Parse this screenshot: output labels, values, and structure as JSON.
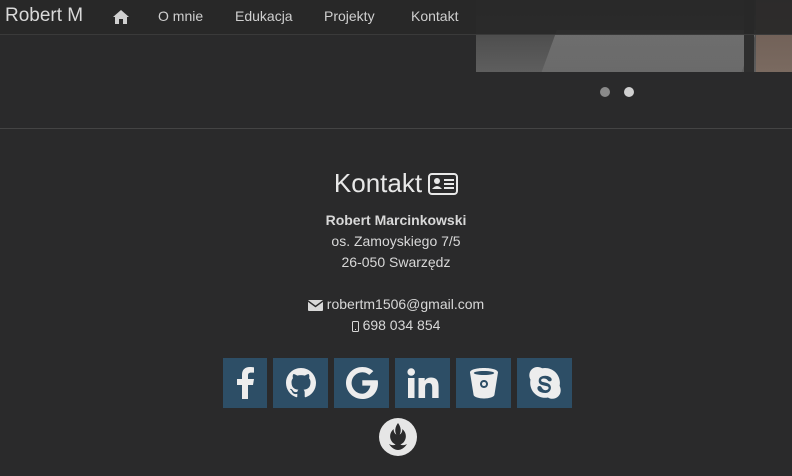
{
  "nav": {
    "brand": "Robert M",
    "items": [
      "O mnie",
      "Edukacja",
      "Projekty",
      "Kontakt"
    ]
  },
  "carousel": {
    "slides": 2,
    "active_index": 1
  },
  "contact": {
    "title": "Kontakt",
    "name": "Robert Marcinkowski",
    "address_line1": "os. Zamoyskiego 7/5",
    "address_line2": "26-050 Swarzędz",
    "email": "robertm1506@gmail.com",
    "phone": "698 034 854"
  },
  "social": [
    "facebook-icon",
    "github-icon",
    "google-icon",
    "linkedin-icon",
    "bitbucket-icon",
    "skype-icon"
  ],
  "colors": {
    "background": "#2a2a2b",
    "navbar": "#282828",
    "social_button": "#2d4e66",
    "text": "#d8d8d8"
  }
}
